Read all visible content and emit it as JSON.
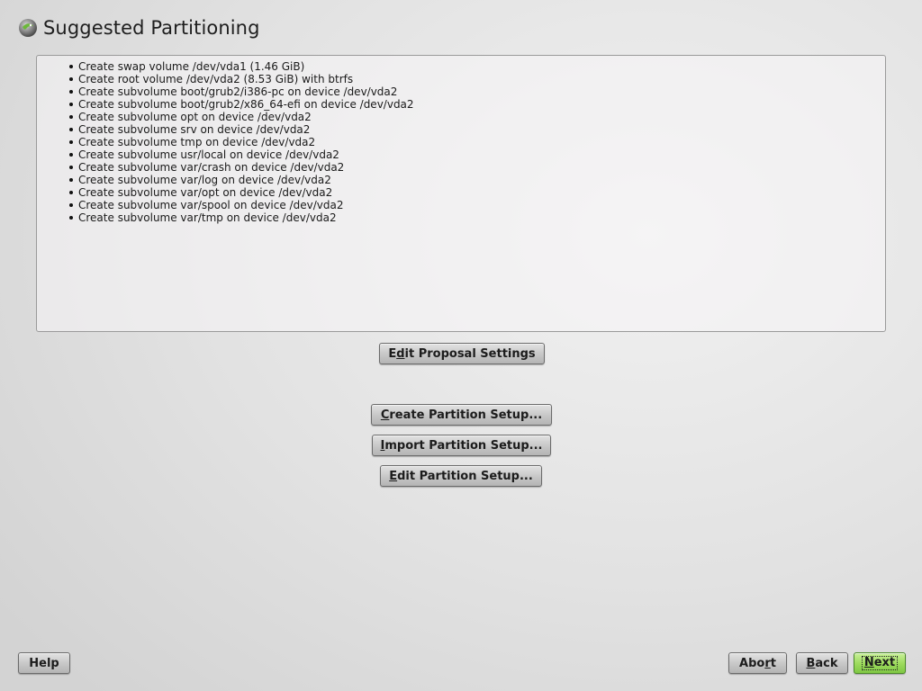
{
  "header": {
    "title": "Suggested Partitioning",
    "icon": "yast-logo-icon"
  },
  "summary": {
    "items": [
      "Create swap volume /dev/vda1 (1.46 GiB)",
      "Create root volume /dev/vda2 (8.53 GiB) with btrfs",
      "Create subvolume boot/grub2/i386-pc on device /dev/vda2",
      "Create subvolume boot/grub2/x86_64-efi on device /dev/vda2",
      "Create subvolume opt on device /dev/vda2",
      "Create subvolume srv on device /dev/vda2",
      "Create subvolume tmp on device /dev/vda2",
      "Create subvolume usr/local on device /dev/vda2",
      "Create subvolume var/crash on device /dev/vda2",
      "Create subvolume var/log on device /dev/vda2",
      "Create subvolume var/opt on device /dev/vda2",
      "Create subvolume var/spool on device /dev/vda2",
      "Create subvolume var/tmp on device /dev/vda2"
    ]
  },
  "buttons": {
    "edit_proposal": {
      "pre": "E",
      "acc": "d",
      "post": "it Proposal Settings"
    },
    "create_setup": {
      "pre": "",
      "acc": "C",
      "post": "reate Partition Setup..."
    },
    "import_setup": {
      "pre": "",
      "acc": "I",
      "post": "mport Partition Setup..."
    },
    "edit_setup": {
      "pre": "",
      "acc": "E",
      "post": "dit Partition Setup..."
    },
    "help": {
      "pre": "",
      "acc": "",
      "post": "Help"
    },
    "abort": {
      "pre": "Abo",
      "acc": "r",
      "post": "t"
    },
    "back": {
      "pre": "",
      "acc": "B",
      "post": "ack"
    },
    "next": {
      "pre": "",
      "acc": "N",
      "post": "ext"
    }
  },
  "colors": {
    "next_button": "#9fdc5f",
    "logo_green": "#6cb83a"
  }
}
